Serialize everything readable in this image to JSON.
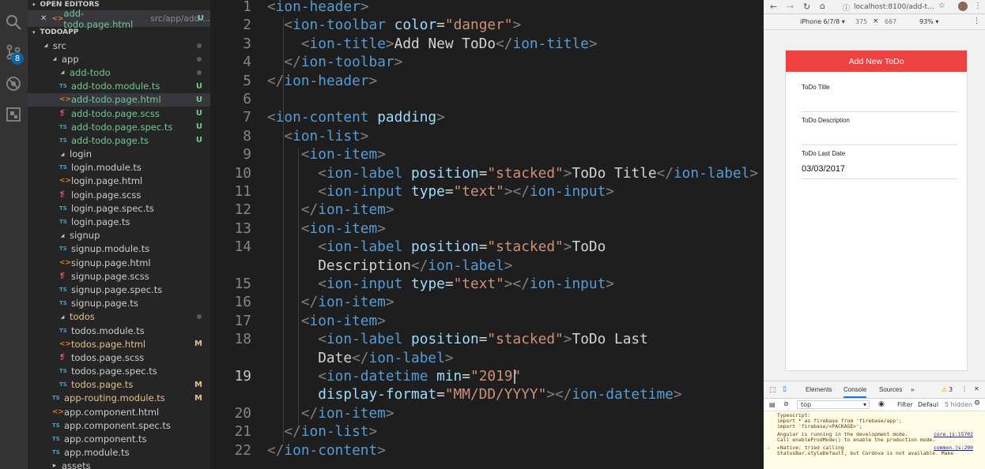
{
  "sidebar": {
    "open_editors_title": "OPEN EDITORS",
    "open_editor": {
      "name": "add-todo.page.html",
      "path": "src/app/add-...",
      "status": "U"
    },
    "project_title": "TODOAPP",
    "badge_count": "8",
    "tree": [
      {
        "label": "src",
        "type": "folder",
        "depth": 0,
        "status": "",
        "dot": true
      },
      {
        "label": "app",
        "type": "folder",
        "depth": 1,
        "status": "",
        "dot": true
      },
      {
        "label": "add-todo",
        "type": "folder",
        "depth": 2,
        "status": "",
        "dot": true,
        "color": "u"
      },
      {
        "label": "add-todo.module.ts",
        "type": "ts",
        "depth": 3,
        "status": "U"
      },
      {
        "label": "add-todo.page.html",
        "type": "html",
        "depth": 3,
        "status": "U",
        "selected": true
      },
      {
        "label": "add-todo.page.scss",
        "type": "scss",
        "depth": 3,
        "status": "U"
      },
      {
        "label": "add-todo.page.spec.ts",
        "type": "ts",
        "depth": 3,
        "status": "U"
      },
      {
        "label": "add-todo.page.ts",
        "type": "ts",
        "depth": 3,
        "status": "U"
      },
      {
        "label": "login",
        "type": "folder",
        "depth": 2,
        "status": ""
      },
      {
        "label": "login.module.ts",
        "type": "ts",
        "depth": 3,
        "status": ""
      },
      {
        "label": "login.page.html",
        "type": "html",
        "depth": 3,
        "status": ""
      },
      {
        "label": "login.page.scss",
        "type": "scss",
        "depth": 3,
        "status": ""
      },
      {
        "label": "login.page.spec.ts",
        "type": "ts",
        "depth": 3,
        "status": ""
      },
      {
        "label": "login.page.ts",
        "type": "ts",
        "depth": 3,
        "status": ""
      },
      {
        "label": "signup",
        "type": "folder",
        "depth": 2,
        "status": ""
      },
      {
        "label": "signup.module.ts",
        "type": "ts",
        "depth": 3,
        "status": ""
      },
      {
        "label": "signup.page.html",
        "type": "html",
        "depth": 3,
        "status": ""
      },
      {
        "label": "signup.page.scss",
        "type": "scss",
        "depth": 3,
        "status": ""
      },
      {
        "label": "signup.page.spec.ts",
        "type": "ts",
        "depth": 3,
        "status": ""
      },
      {
        "label": "signup.page.ts",
        "type": "ts",
        "depth": 3,
        "status": ""
      },
      {
        "label": "todos",
        "type": "folder",
        "depth": 2,
        "status": "",
        "dot": true,
        "color": "m"
      },
      {
        "label": "todos.module.ts",
        "type": "ts",
        "depth": 3,
        "status": ""
      },
      {
        "label": "todos.page.html",
        "type": "html",
        "depth": 3,
        "status": "M"
      },
      {
        "label": "todos.page.scss",
        "type": "scss",
        "depth": 3,
        "status": ""
      },
      {
        "label": "todos.page.spec.ts",
        "type": "ts",
        "depth": 3,
        "status": ""
      },
      {
        "label": "todos.page.ts",
        "type": "ts",
        "depth": 3,
        "status": "M"
      },
      {
        "label": "app-routing.module.ts",
        "type": "ts",
        "depth": 2,
        "status": "M"
      },
      {
        "label": "app.component.html",
        "type": "html",
        "depth": 2,
        "status": ""
      },
      {
        "label": "app.component.spec.ts",
        "type": "ts",
        "depth": 2,
        "status": ""
      },
      {
        "label": "app.component.ts",
        "type": "ts",
        "depth": 2,
        "status": ""
      },
      {
        "label": "app.module.ts",
        "type": "ts",
        "depth": 2,
        "status": ""
      },
      {
        "label": "assets",
        "type": "folder-closed",
        "depth": 1,
        "status": ""
      }
    ]
  },
  "editor": {
    "current_line": "19",
    "lines": [
      {
        "n": "1",
        "parts": [
          [
            "ang",
            "<"
          ],
          [
            "tag",
            "ion-header"
          ],
          [
            "ang",
            ">"
          ]
        ]
      },
      {
        "n": "2",
        "parts": [
          [
            "txt",
            "  "
          ],
          [
            "ang",
            "<"
          ],
          [
            "tag",
            "ion-toolbar"
          ],
          [
            "txt",
            " "
          ],
          [
            "attr",
            "color"
          ],
          [
            "txt",
            "="
          ],
          [
            "str",
            "\"danger\""
          ],
          [
            "ang",
            ">"
          ]
        ]
      },
      {
        "n": "3",
        "parts": [
          [
            "txt",
            "    "
          ],
          [
            "ang",
            "<"
          ],
          [
            "tag",
            "ion-title"
          ],
          [
            "ang",
            ">"
          ],
          [
            "txt",
            "Add New ToDo"
          ],
          [
            "ang",
            "</"
          ],
          [
            "tag",
            "ion-title"
          ],
          [
            "ang",
            ">"
          ]
        ]
      },
      {
        "n": "4",
        "parts": [
          [
            "txt",
            "  "
          ],
          [
            "ang",
            "</"
          ],
          [
            "tag",
            "ion-toolbar"
          ],
          [
            "ang",
            ">"
          ]
        ]
      },
      {
        "n": "5",
        "parts": [
          [
            "ang",
            "</"
          ],
          [
            "tag",
            "ion-header"
          ],
          [
            "ang",
            ">"
          ]
        ]
      },
      {
        "n": "6",
        "parts": []
      },
      {
        "n": "7",
        "parts": [
          [
            "ang",
            "<"
          ],
          [
            "tag",
            "ion-content"
          ],
          [
            "txt",
            " "
          ],
          [
            "attr",
            "padding"
          ],
          [
            "ang",
            ">"
          ]
        ]
      },
      {
        "n": "8",
        "parts": [
          [
            "txt",
            "  "
          ],
          [
            "ang",
            "<"
          ],
          [
            "tag",
            "ion-list"
          ],
          [
            "ang",
            ">"
          ]
        ]
      },
      {
        "n": "9",
        "parts": [
          [
            "txt",
            "    "
          ],
          [
            "ang",
            "<"
          ],
          [
            "tag",
            "ion-item"
          ],
          [
            "ang",
            ">"
          ]
        ]
      },
      {
        "n": "10",
        "parts": [
          [
            "txt",
            "      "
          ],
          [
            "ang",
            "<"
          ],
          [
            "tag",
            "ion-label"
          ],
          [
            "txt",
            " "
          ],
          [
            "attr",
            "position"
          ],
          [
            "txt",
            "="
          ],
          [
            "str",
            "\"stacked\""
          ],
          [
            "ang",
            ">"
          ],
          [
            "txt",
            "ToDo Title"
          ],
          [
            "ang",
            "</"
          ],
          [
            "tag",
            "ion-label"
          ],
          [
            "ang",
            ">"
          ]
        ]
      },
      {
        "n": "11",
        "parts": [
          [
            "txt",
            "      "
          ],
          [
            "ang",
            "<"
          ],
          [
            "tag",
            "ion-input"
          ],
          [
            "txt",
            " "
          ],
          [
            "attr",
            "type"
          ],
          [
            "txt",
            "="
          ],
          [
            "str",
            "\"text\""
          ],
          [
            "ang",
            "></"
          ],
          [
            "tag",
            "ion-input"
          ],
          [
            "ang",
            ">"
          ]
        ]
      },
      {
        "n": "12",
        "parts": [
          [
            "txt",
            "    "
          ],
          [
            "ang",
            "</"
          ],
          [
            "tag",
            "ion-item"
          ],
          [
            "ang",
            ">"
          ]
        ]
      },
      {
        "n": "13",
        "parts": [
          [
            "txt",
            "    "
          ],
          [
            "ang",
            "<"
          ],
          [
            "tag",
            "ion-item"
          ],
          [
            "ang",
            ">"
          ]
        ]
      },
      {
        "n": "14",
        "parts": [
          [
            "txt",
            "      "
          ],
          [
            "ang",
            "<"
          ],
          [
            "tag",
            "ion-label"
          ],
          [
            "txt",
            " "
          ],
          [
            "attr",
            "position"
          ],
          [
            "txt",
            "="
          ],
          [
            "str",
            "\"stacked\""
          ],
          [
            "ang",
            ">"
          ],
          [
            "txt",
            "ToDo"
          ]
        ]
      },
      {
        "n": "",
        "parts": [
          [
            "txt",
            "      Description"
          ],
          [
            "ang",
            "</"
          ],
          [
            "tag",
            "ion-label"
          ],
          [
            "ang",
            ">"
          ]
        ]
      },
      {
        "n": "15",
        "parts": [
          [
            "txt",
            "      "
          ],
          [
            "ang",
            "<"
          ],
          [
            "tag",
            "ion-input"
          ],
          [
            "txt",
            " "
          ],
          [
            "attr",
            "type"
          ],
          [
            "txt",
            "="
          ],
          [
            "str",
            "\"text\""
          ],
          [
            "ang",
            "></"
          ],
          [
            "tag",
            "ion-input"
          ],
          [
            "ang",
            ">"
          ]
        ]
      },
      {
        "n": "16",
        "parts": [
          [
            "txt",
            "    "
          ],
          [
            "ang",
            "</"
          ],
          [
            "tag",
            "ion-item"
          ],
          [
            "ang",
            ">"
          ]
        ]
      },
      {
        "n": "17",
        "parts": [
          [
            "txt",
            "    "
          ],
          [
            "ang",
            "<"
          ],
          [
            "tag",
            "ion-item"
          ],
          [
            "ang",
            ">"
          ]
        ]
      },
      {
        "n": "18",
        "parts": [
          [
            "txt",
            "      "
          ],
          [
            "ang",
            "<"
          ],
          [
            "tag",
            "ion-label"
          ],
          [
            "txt",
            " "
          ],
          [
            "attr",
            "position"
          ],
          [
            "txt",
            "="
          ],
          [
            "str",
            "\"stacked\""
          ],
          [
            "ang",
            ">"
          ],
          [
            "txt",
            "ToDo Last"
          ]
        ]
      },
      {
        "n": "",
        "parts": [
          [
            "txt",
            "      Date"
          ],
          [
            "ang",
            "</"
          ],
          [
            "tag",
            "ion-label"
          ],
          [
            "ang",
            ">"
          ]
        ]
      },
      {
        "n": "19",
        "parts": [
          [
            "txt",
            "      "
          ],
          [
            "ang",
            "<"
          ],
          [
            "tag",
            "ion-datetime"
          ],
          [
            "txt",
            " "
          ],
          [
            "attr",
            "min"
          ],
          [
            "txt",
            "="
          ],
          [
            "str",
            "\"2019\""
          ]
        ]
      },
      {
        "n": "",
        "parts": [
          [
            "txt",
            "      "
          ],
          [
            "attr",
            "display-format"
          ],
          [
            "txt",
            "="
          ],
          [
            "str",
            "\"MM/DD/YYYY\""
          ],
          [
            "ang",
            "></"
          ],
          [
            "tag",
            "ion-datetime"
          ],
          [
            "ang",
            ">"
          ]
        ]
      },
      {
        "n": "20",
        "parts": [
          [
            "txt",
            "    "
          ],
          [
            "ang",
            "</"
          ],
          [
            "tag",
            "ion-item"
          ],
          [
            "ang",
            ">"
          ]
        ]
      },
      {
        "n": "21",
        "parts": [
          [
            "txt",
            "  "
          ],
          [
            "ang",
            "</"
          ],
          [
            "tag",
            "ion-list"
          ],
          [
            "ang",
            ">"
          ]
        ]
      },
      {
        "n": "22",
        "parts": [
          [
            "ang",
            "</"
          ],
          [
            "tag",
            "ion-content"
          ],
          [
            "ang",
            ">"
          ]
        ]
      }
    ]
  },
  "browser": {
    "url": "localhost:8100/add-t...",
    "device": "iPhone 6/7/8 ▾",
    "width": "375",
    "height": "667",
    "zoom": "93% ▾",
    "app": {
      "header_title": "Add New ToDo",
      "accent_color": "#f04141",
      "fields": [
        {
          "label": "ToDo Title",
          "value": ""
        },
        {
          "label": "ToDo Description",
          "value": ""
        },
        {
          "label": "ToDo Last Date",
          "value": "03/03/2017"
        }
      ]
    }
  },
  "devtools": {
    "tabs": [
      "Elements",
      "Console",
      "Sources",
      "»"
    ],
    "active_tab": "Console",
    "warnings_count": "3",
    "context": "top",
    "filter_label": "Filter",
    "levels": "Defaul",
    "hidden": "5 hidden",
    "console_lines": [
      {
        "text": "Typescript:",
        "src": ""
      },
      {
        "text": "import * as firebase from 'firebase/app';",
        "src": ""
      },
      {
        "text": "import 'firebase/<PACKAGE>';",
        "src": ""
      },
      {
        "text": "Angular is running in the development mode.",
        "src": "core.js:15702"
      },
      {
        "text": "Call enableProdMode() to enable the production mode.",
        "src": ""
      },
      {
        "text": "▸Native: tried calling",
        "src": "common.js:290"
      },
      {
        "text": "StatusBar.styleDefault, but Cordova is not available. Make",
        "src": ""
      }
    ]
  }
}
